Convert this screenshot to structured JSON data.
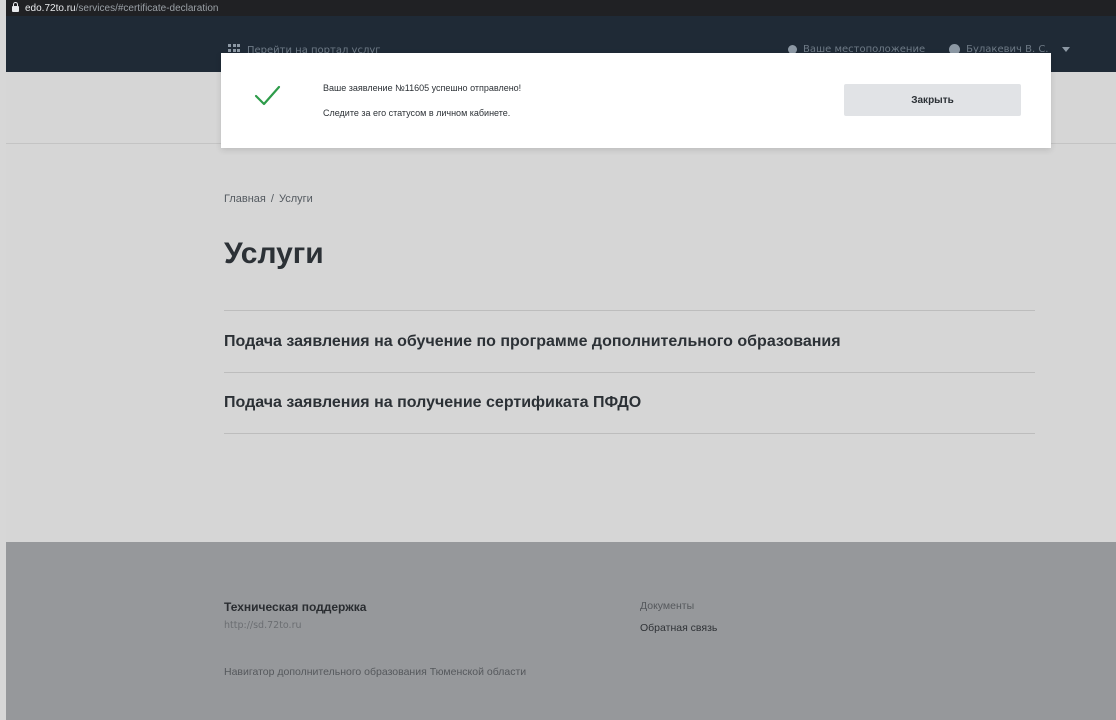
{
  "browser": {
    "host": "edo.72to.ru",
    "path": "/services/#certificate-declaration"
  },
  "topnav": {
    "portal_label": "Перейти на портал услуг",
    "location_label": "Ваше местоположение",
    "user_name": "Булакевич В. С."
  },
  "breadcrumb": {
    "home": "Главная",
    "separator": "/",
    "current": "Услуги"
  },
  "page": {
    "title": "Услуги"
  },
  "services": [
    {
      "label": "Подача заявления на обучение по программе дополнительного образования"
    },
    {
      "label": "Подача заявления на получение сертификата ПФДО"
    }
  ],
  "footer": {
    "support_title": "Техническая поддержка",
    "support_url": "http://sd.72to.ru",
    "documents_link": "Документы",
    "feedback_link": "Обратная связь",
    "copyright": "Навигатор дополнительного образования Тюменской области"
  },
  "toast": {
    "line1": "Ваше заявление №11605 успешно отправлено!",
    "line2": "Следите за его статусом в личном кабинете.",
    "close_label": "Закрыть",
    "icon": "check-icon",
    "accent_color": "#2e9c4a"
  }
}
